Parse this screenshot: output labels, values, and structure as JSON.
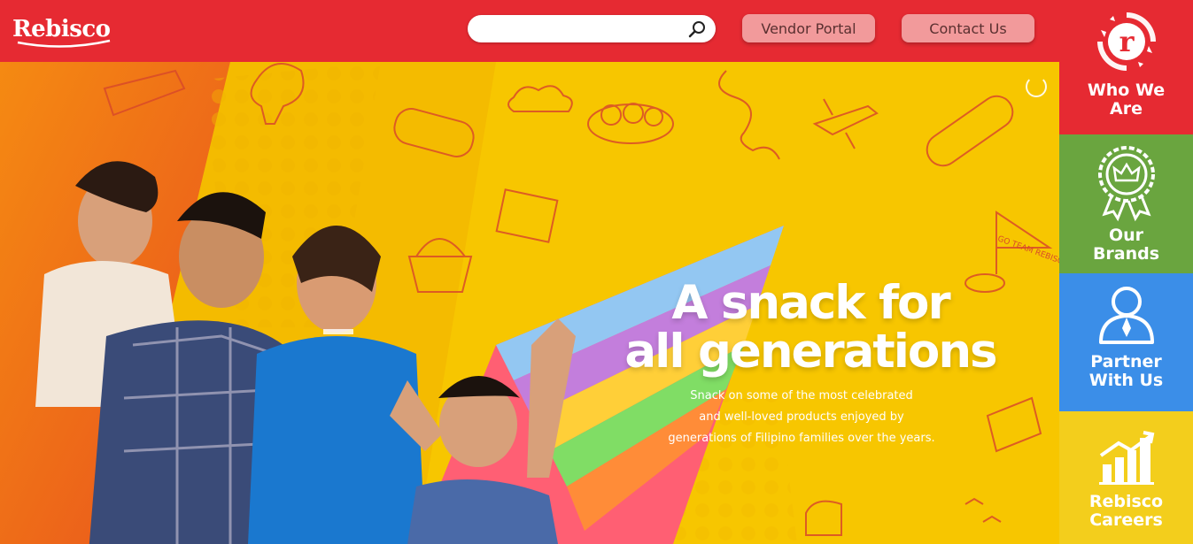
{
  "header": {
    "logo_text": "Rebisco",
    "search": {
      "placeholder": "",
      "value": ""
    },
    "vendor_portal_label": "Vendor Portal",
    "contact_us_label": "Contact Us"
  },
  "hero": {
    "headline_line1": "A snack for",
    "headline_line2": "all generations",
    "subtext_lines": [
      "Snack on some of the most celebrated",
      "and well-loved products enjoyed by",
      "generations of Filipino families over the years."
    ],
    "doodle_flag_text": "GO TEAM REBISCO!"
  },
  "sidenav": {
    "items": [
      {
        "line1": "Who We",
        "line2": "Are",
        "icon": "rebisco-r-icon",
        "color": "#e62a32"
      },
      {
        "line1": "Our",
        "line2": "Brands",
        "icon": "crown-badge-icon",
        "color": "#6aa53f"
      },
      {
        "line1": "Partner",
        "line2": "With Us",
        "icon": "partner-person-icon",
        "color": "#3b8ee8"
      },
      {
        "line1": "Rebisco",
        "line2": "Careers",
        "icon": "career-growth-icon",
        "color": "#f3ce1c"
      }
    ]
  },
  "colors": {
    "header_red": "#e62a32",
    "button_pink": "#f29a9b",
    "hero_yellow": "#f7c600",
    "hero_orange": "#f07a18"
  }
}
